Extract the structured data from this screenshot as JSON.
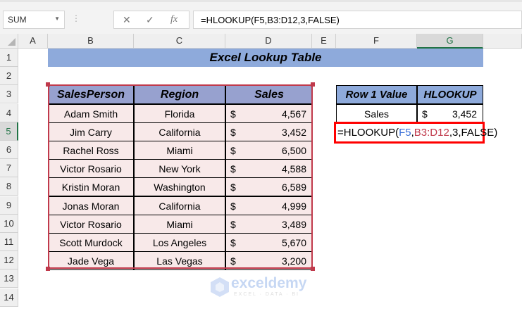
{
  "name_box": "SUM",
  "formula_bar": "=HLOOKUP(F5,B3:D12,3,FALSE)",
  "fx_icon": "fx",
  "columns": [
    "A",
    "B",
    "C",
    "D",
    "E",
    "F",
    "G"
  ],
  "rows": [
    "1",
    "2",
    "3",
    "4",
    "5",
    "6",
    "7",
    "8",
    "9",
    "10",
    "11",
    "12",
    "13",
    "14"
  ],
  "title": "Excel Lookup Table",
  "table": {
    "headers": [
      "SalesPerson",
      "Region",
      "Sales"
    ],
    "rows": [
      [
        "Adam Smith",
        "Florida",
        "$",
        "4,567"
      ],
      [
        "Jim Carry",
        "California",
        "$",
        "3,452"
      ],
      [
        "Rachel Ross",
        "Miami",
        "$",
        "6,500"
      ],
      [
        "Victor Rosario",
        "New York",
        "$",
        "4,588"
      ],
      [
        "Kristin Moran",
        "Washington",
        "$",
        "6,589"
      ],
      [
        "Jonas Moran",
        "California",
        "$",
        "4,999"
      ],
      [
        "Victor Rosario",
        "Miami",
        "$",
        "3,489"
      ],
      [
        "Scott Murdock",
        "Los Angeles",
        "$",
        "5,670"
      ],
      [
        "Jade Vega",
        "Las Vegas",
        "$",
        "3,200"
      ]
    ]
  },
  "lookup": {
    "headers": [
      "Row 1 Value",
      "HLOOKUP"
    ],
    "value": "Sales",
    "currency": "$",
    "result": "3,452"
  },
  "formula_parts": [
    {
      "t": "=HLOOKUP(",
      "c": "#000000"
    },
    {
      "t": "F5",
      "c": "#3a6fd8"
    },
    {
      "t": ",",
      "c": "#000000"
    },
    {
      "t": "B3:D12",
      "c": "#c0394b"
    },
    {
      "t": ",3,FALSE)",
      "c": "#000000"
    }
  ],
  "watermark": {
    "name": "exceldemy",
    "tagline": "EXCEL · DATA · BI"
  }
}
